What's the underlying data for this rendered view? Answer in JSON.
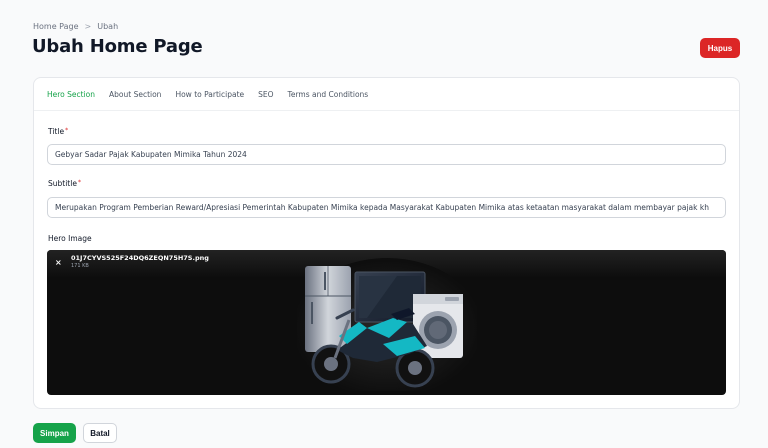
{
  "breadcrumb": {
    "home": "Home Page",
    "separator": ">",
    "current": "Ubah"
  },
  "page_title": "Ubah Home Page",
  "actions": {
    "delete_label": "Hapus"
  },
  "tabs": [
    {
      "label": "Hero Section",
      "active": true
    },
    {
      "label": "About Section",
      "active": false
    },
    {
      "label": "How to Participate",
      "active": false
    },
    {
      "label": "SEO",
      "active": false
    },
    {
      "label": "Terms and Conditions",
      "active": false
    }
  ],
  "form": {
    "title_label": "Title",
    "title_value": "Gebyar Sadar Pajak Kabupaten Mimika Tahun 2024",
    "subtitle_label": "Subtitle",
    "subtitle_value": "Merupakan Program Pemberian Reward/Apresiasi Pemerintah Kabupaten Mimika kepada Masyarakat Kabupaten Mimika atas ketaatan masyarakat dalam membayar pajak kh",
    "required_mark": "*",
    "hero_image_label": "Hero Image",
    "hero_file": {
      "name": "01J7CYVS525F24DQ6ZEQN75H7S.png",
      "size": "171 KB",
      "remove_icon": "×"
    }
  },
  "footer": {
    "save_label": "Simpan",
    "cancel_label": "Batal"
  },
  "colors": {
    "primary": "#16a34a",
    "danger": "#dc2626",
    "image_bg": "#0d0d0d"
  }
}
